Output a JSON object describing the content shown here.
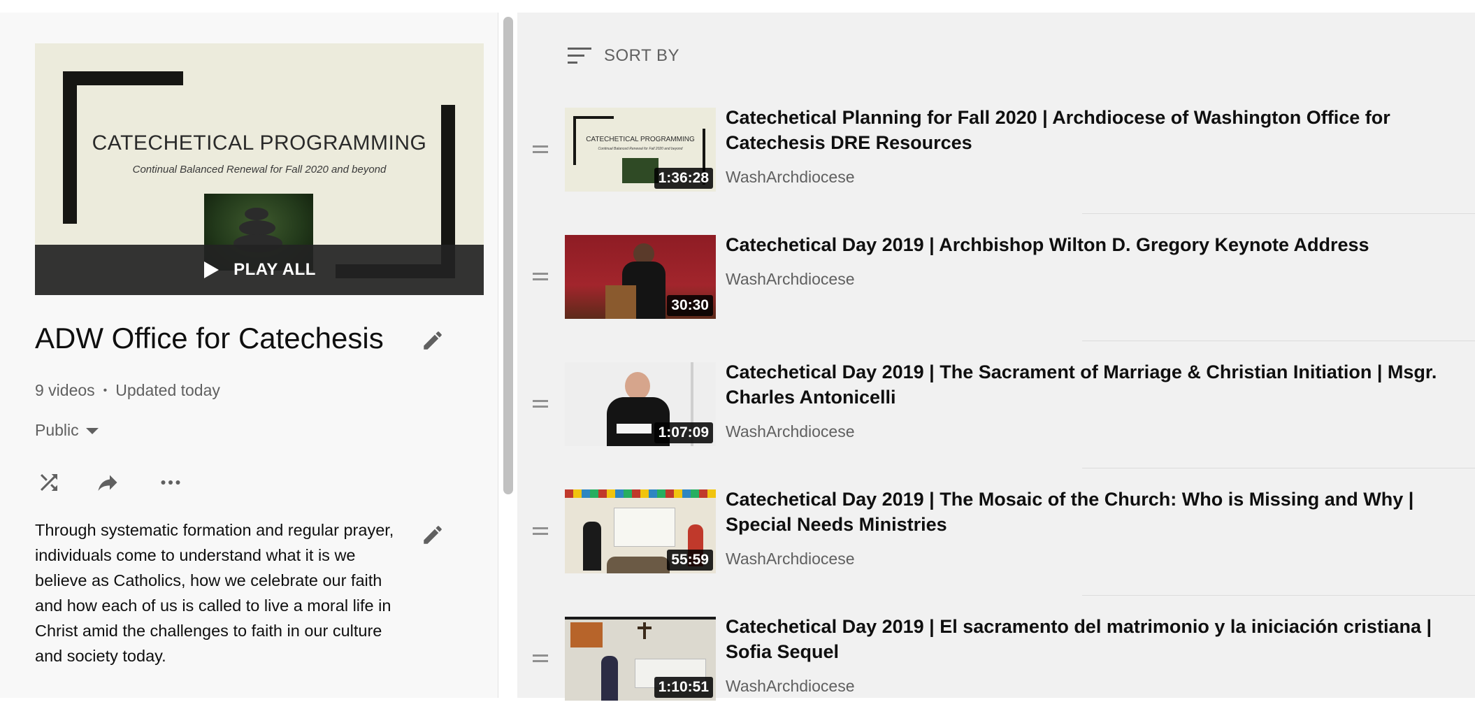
{
  "playlist": {
    "thumbnail": {
      "title": "CATECHETICAL PROGRAMMING",
      "subtitle": "Continual Balanced Renewal for Fall 2020 and beyond"
    },
    "play_all_label": "PLAY ALL",
    "title": "ADW Office for Catechesis",
    "video_count": "9 videos",
    "updated": "Updated today",
    "privacy": "Public",
    "description": "Through systematic formation and regular prayer, individuals come to understand what it is we believe as Catholics, how we celebrate our faith and how each of us is called to live a moral life in Christ amid the challenges to faith in our culture and society today."
  },
  "icons": {
    "edit": "pencil-icon",
    "shuffle": "shuffle-icon",
    "share": "share-icon",
    "more": "more-horizontal-icon",
    "sort": "sort-icon",
    "play": "play-icon",
    "drag": "drag-handle-icon"
  },
  "sort": {
    "label": "SORT BY"
  },
  "videos": [
    {
      "title": "Catechetical Planning for Fall 2020 | Archdiocese of Washington Office for Catechesis DRE Resources",
      "channel": "WashArchdiocese",
      "duration": "1:36:28",
      "thumb_title": "CATECHETICAL PROGRAMMING",
      "thumb_subtitle": "Continual Balanced Renewal for Fall 2020 and beyond"
    },
    {
      "title": "Catechetical Day 2019 | Archbishop Wilton D. Gregory Keynote Address",
      "channel": "WashArchdiocese",
      "duration": "30:30"
    },
    {
      "title": "Catechetical Day 2019 | The Sacrament of Marriage & Christian Initiation | Msgr. Charles Antonicelli",
      "channel": "WashArchdiocese",
      "duration": "1:07:09"
    },
    {
      "title": "Catechetical Day 2019 | The Mosaic of the Church: Who is Missing and Why | Special Needs Ministries",
      "channel": "WashArchdiocese",
      "duration": "55:59"
    },
    {
      "title": "Catechetical Day 2019 | El sacramento del matrimonio y la iniciación cristiana | Sofia Sequel",
      "channel": "WashArchdiocese",
      "duration": "1:10:51"
    }
  ],
  "colors": {
    "text_primary": "#0f0f0f",
    "text_secondary": "#606060",
    "left_bg": "#f8f8f8",
    "right_bg": "#f1f1f1"
  }
}
